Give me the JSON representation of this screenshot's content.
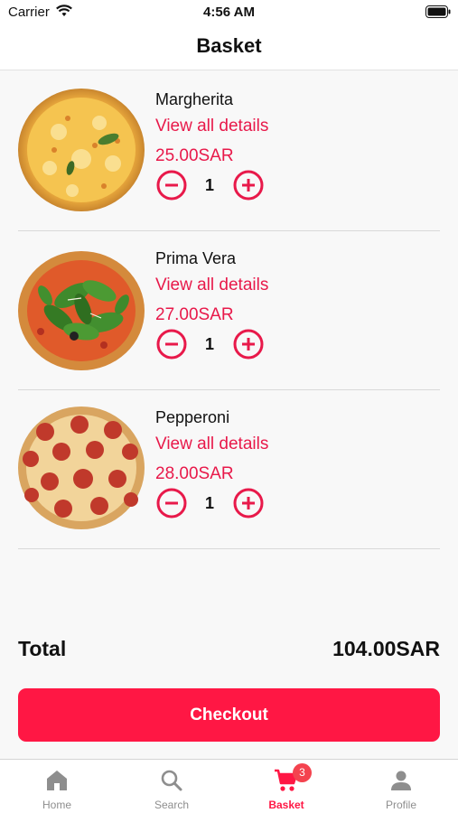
{
  "status_bar": {
    "carrier": "Carrier",
    "time": "4:56 AM"
  },
  "nav": {
    "title": "Basket"
  },
  "items": [
    {
      "name": "Margherita",
      "details_link": "View all details",
      "price": "25.00SAR",
      "quantity": "1"
    },
    {
      "name": "Prima Vera",
      "details_link": "View all details",
      "price": "27.00SAR",
      "quantity": "1"
    },
    {
      "name": "Pepperoni",
      "details_link": "View all details",
      "price": "28.00SAR",
      "quantity": "1"
    }
  ],
  "total": {
    "label": "Total",
    "value": "104.00SAR"
  },
  "checkout": {
    "label": "Checkout"
  },
  "tabs": [
    {
      "label": "Home",
      "icon": "home-icon"
    },
    {
      "label": "Search",
      "icon": "search-icon"
    },
    {
      "label": "Basket",
      "icon": "cart-icon",
      "badge": "3",
      "active": true
    },
    {
      "label": "Profile",
      "icon": "person-icon"
    }
  ],
  "colors": {
    "accent": "#ff1744",
    "link": "#e8194a",
    "badge": "#f4434f",
    "inactive_tab": "#8e8e8e"
  }
}
